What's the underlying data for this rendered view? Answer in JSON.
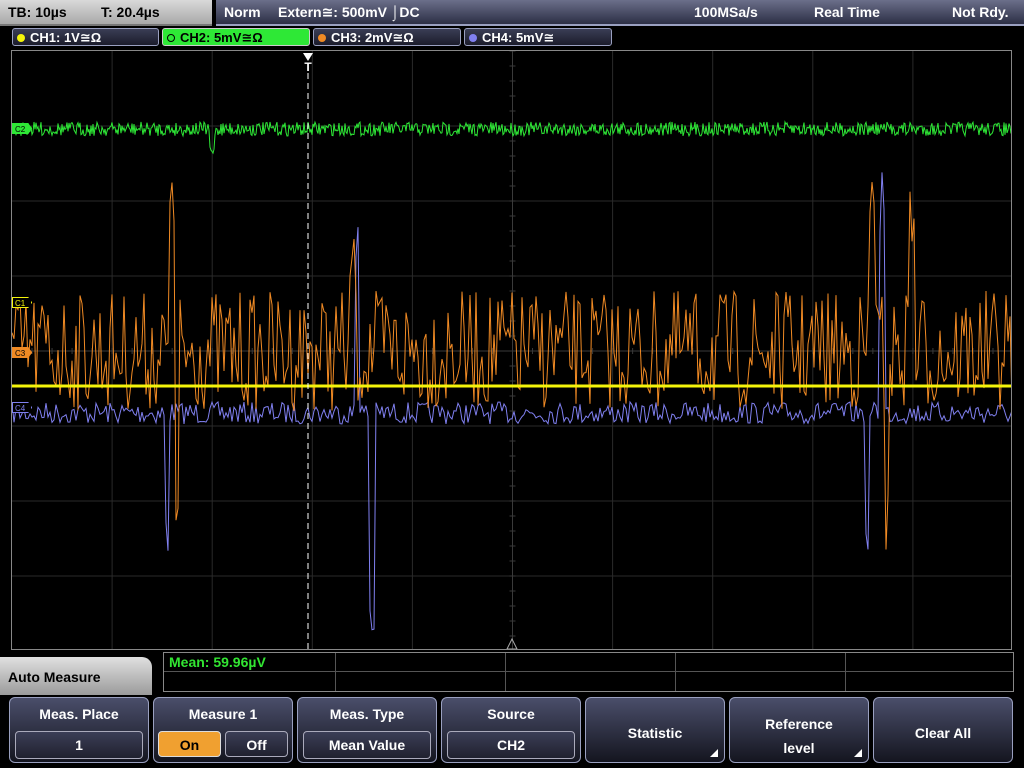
{
  "top": {
    "timebase": "TB: 10µs",
    "trigger_time": "T: 20.4µs",
    "mode": "Norm",
    "trigger_source": "Extern≅: 500mV ⌡DC",
    "sample_rate": "100MSa/s",
    "acq_mode": "Real Time",
    "state": "Not Rdy."
  },
  "channels": [
    {
      "label": "CH1: 1V≅Ω",
      "color": "#f4f40a",
      "active": false
    },
    {
      "label": "CH2: 5mV≅Ω",
      "color": "#2ee836",
      "active": true
    },
    {
      "label": "CH3: 2mV≅Ω",
      "color": "#f08a24",
      "active": false
    },
    {
      "label": "CH4: 5mV≅",
      "color": "#8080f0",
      "active": false
    }
  ],
  "markers": {
    "c2": "C2",
    "c1": "C1",
    "c3": "C3",
    "c4": "C4"
  },
  "trigger_marker": "T",
  "measurement": {
    "mean": "Mean: 59.96µV"
  },
  "auto_measure": "Auto Measure",
  "softkeys": {
    "meas_place": {
      "title": "Meas. Place",
      "value": "1"
    },
    "measure1": {
      "title": "Measure 1",
      "on": "On",
      "off": "Off"
    },
    "meas_type": {
      "title": "Meas. Type",
      "value": "Mean Value"
    },
    "source": {
      "title": "Source",
      "value": "CH2"
    },
    "statistic": {
      "label": "Statistic"
    },
    "reference_level": {
      "line1": "Reference",
      "line2": "level"
    },
    "clear_all": {
      "label": "Clear All"
    }
  }
}
